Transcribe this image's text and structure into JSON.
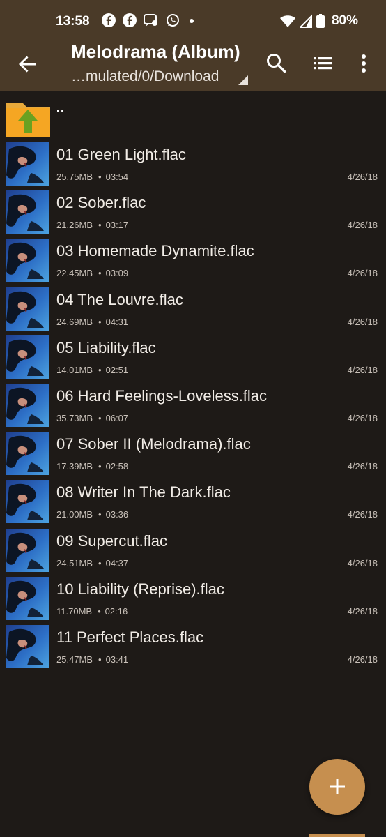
{
  "status": {
    "time": "13:58",
    "app_icons": [
      "facebook-icon",
      "facebook-icon",
      "messages-icon",
      "whatsapp-icon",
      "dot-icon"
    ],
    "battery": "80%"
  },
  "appbar": {
    "title": "Melodrama (Album)",
    "path": "…mulated/0/Download"
  },
  "parent": {
    "label": ".."
  },
  "files": [
    {
      "name": "01 Green Light.flac",
      "size": "25.75MB",
      "duration": "03:54",
      "date": "4/26/18"
    },
    {
      "name": "02 Sober.flac",
      "size": "21.26MB",
      "duration": "03:17",
      "date": "4/26/18"
    },
    {
      "name": "03 Homemade Dynamite.flac",
      "size": "22.45MB",
      "duration": "03:09",
      "date": "4/26/18"
    },
    {
      "name": "04 The Louvre.flac",
      "size": "24.69MB",
      "duration": "04:31",
      "date": "4/26/18"
    },
    {
      "name": "05 Liability.flac",
      "size": "14.01MB",
      "duration": "02:51",
      "date": "4/26/18"
    },
    {
      "name": "06 Hard Feelings-Loveless.flac",
      "size": "35.73MB",
      "duration": "06:07",
      "date": "4/26/18"
    },
    {
      "name": "07 Sober II (Melodrama).flac",
      "size": "17.39MB",
      "duration": "02:58",
      "date": "4/26/18"
    },
    {
      "name": "08 Writer In The Dark.flac",
      "size": "21.00MB",
      "duration": "03:36",
      "date": "4/26/18"
    },
    {
      "name": "09 Supercut.flac",
      "size": "24.51MB",
      "duration": "04:37",
      "date": "4/26/18"
    },
    {
      "name": "10 Liability (Reprise).flac",
      "size": "11.70MB",
      "duration": "02:16",
      "date": "4/26/18"
    },
    {
      "name": "11 Perfect Places.flac",
      "size": "25.47MB",
      "duration": "03:41",
      "date": "4/26/18"
    }
  ],
  "colors": {
    "toolbar": "#4a3a28",
    "background": "#1e1a17",
    "accent": "#c68f4f"
  }
}
